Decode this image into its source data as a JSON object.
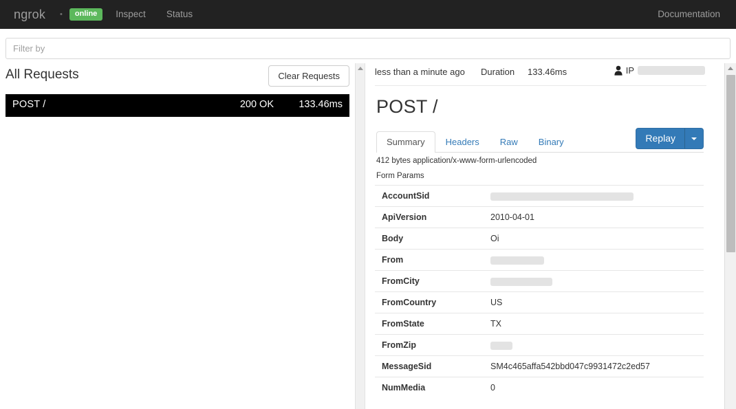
{
  "navbar": {
    "brand": "ngrok",
    "dot": "•",
    "status_badge": "online",
    "links": [
      {
        "label": "Inspect"
      },
      {
        "label": "Status"
      }
    ],
    "right_link": "Documentation",
    "bg_color": "#222222",
    "badge_color": "#5cb85c"
  },
  "filter": {
    "placeholder": "Filter by",
    "value": ""
  },
  "left_panel": {
    "title": "All Requests",
    "clear_button": "Clear Requests",
    "requests": [
      {
        "method_path": "POST /",
        "status": "200 OK",
        "duration": "133.46ms",
        "selected": true
      }
    ]
  },
  "right_panel": {
    "meta": {
      "time_ago": "less than a minute ago",
      "duration_label": "Duration",
      "duration_value": "133.46ms",
      "ip_label": "IP",
      "ip_value_redacted": true
    },
    "title": "POST /",
    "tabs": [
      {
        "label": "Summary",
        "active": true
      },
      {
        "label": "Headers",
        "active": false
      },
      {
        "label": "Raw",
        "active": false
      },
      {
        "label": "Binary",
        "active": false
      }
    ],
    "replay_button": "Replay",
    "replay_caret_icon": "chevron-down-icon",
    "body_meta": "412 bytes application/x-www-form-urlencoded",
    "form_params_label": "Form Params",
    "form_params": [
      {
        "key": "AccountSid",
        "value": "",
        "redacted": true,
        "redact_width": 208
      },
      {
        "key": "ApiVersion",
        "value": "2010-04-01",
        "redacted": false
      },
      {
        "key": "Body",
        "value": "Oi",
        "redacted": false
      },
      {
        "key": "From",
        "value": "",
        "redacted": true,
        "redact_width": 78
      },
      {
        "key": "FromCity",
        "value": "",
        "redacted": true,
        "redact_width": 90
      },
      {
        "key": "FromCountry",
        "value": "US",
        "redacted": false
      },
      {
        "key": "FromState",
        "value": "TX",
        "redacted": false
      },
      {
        "key": "FromZip",
        "value": "",
        "redacted": true,
        "redact_width": 32
      },
      {
        "key": "MessageSid",
        "value": "SM4c465affa542bbd047c9931472c2ed57",
        "redacted": false
      },
      {
        "key": "NumMedia",
        "value": "0",
        "redacted": false
      }
    ]
  },
  "colors": {
    "accent_blue": "#337ab7",
    "online_green": "#5cb85c",
    "selected_row_bg": "#000000",
    "redaction_gray": "#e3e3e3"
  }
}
